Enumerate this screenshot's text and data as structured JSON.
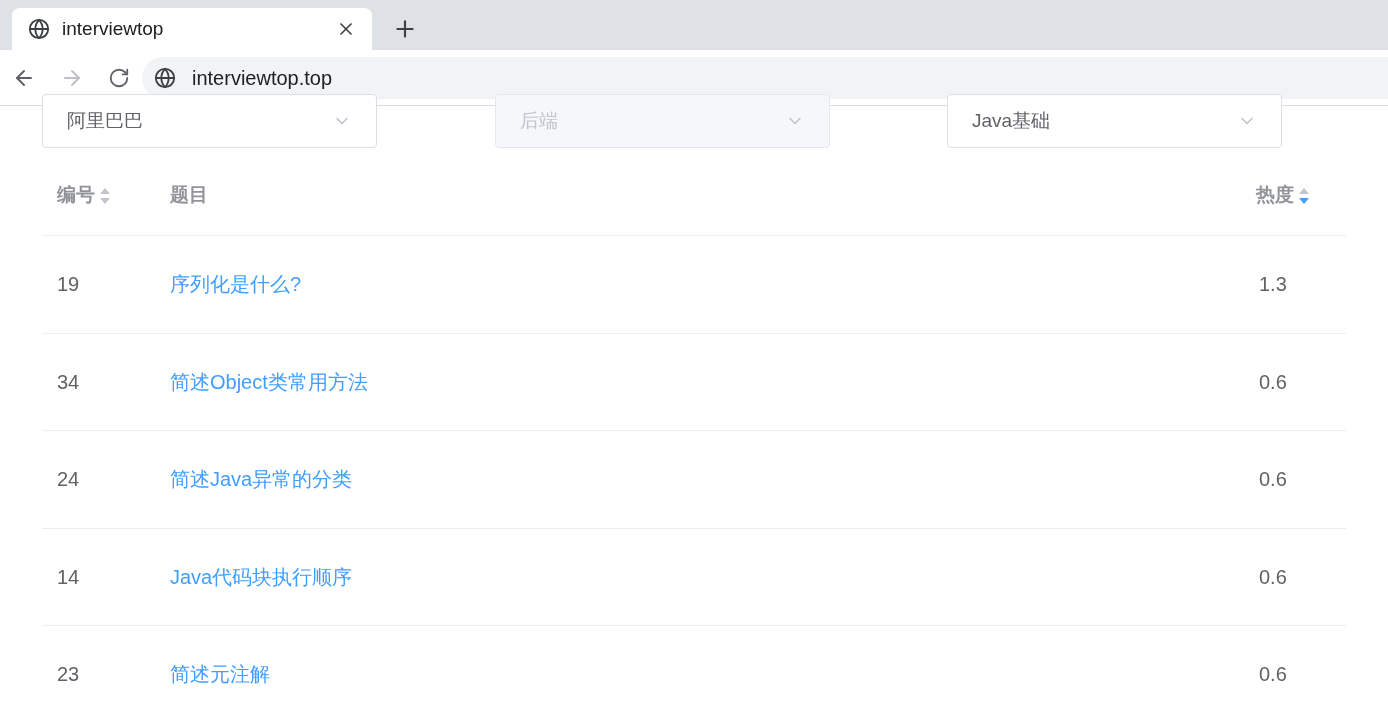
{
  "browser": {
    "tab": {
      "title": "interviewtop",
      "selected": true
    },
    "address": "interviewtop.top"
  },
  "filters": [
    {
      "value": "阿里巴巴",
      "disabled": false
    },
    {
      "value": "后端",
      "disabled": true
    },
    {
      "value": "Java基础",
      "disabled": false
    }
  ],
  "table": {
    "columns": [
      {
        "label": "编号",
        "sortable": true,
        "sorted_ascending": false,
        "sorted_descending": false
      },
      {
        "label": "题目"
      },
      {
        "label": "热度",
        "sortable": true,
        "sorted_ascending": false,
        "sorted_descending": true
      }
    ],
    "rows": [
      {
        "id": "19",
        "title": "序列化是什么?",
        "heat": "1.3"
      },
      {
        "id": "34",
        "title": "简述Object类常用方法",
        "heat": "0.6"
      },
      {
        "id": "24",
        "title": "简述Java异常的分类",
        "heat": "0.6"
      },
      {
        "id": "14",
        "title": "Java代码块执行顺序",
        "heat": "0.6"
      },
      {
        "id": "23",
        "title": "简述元注解",
        "heat": "0.6"
      }
    ]
  }
}
